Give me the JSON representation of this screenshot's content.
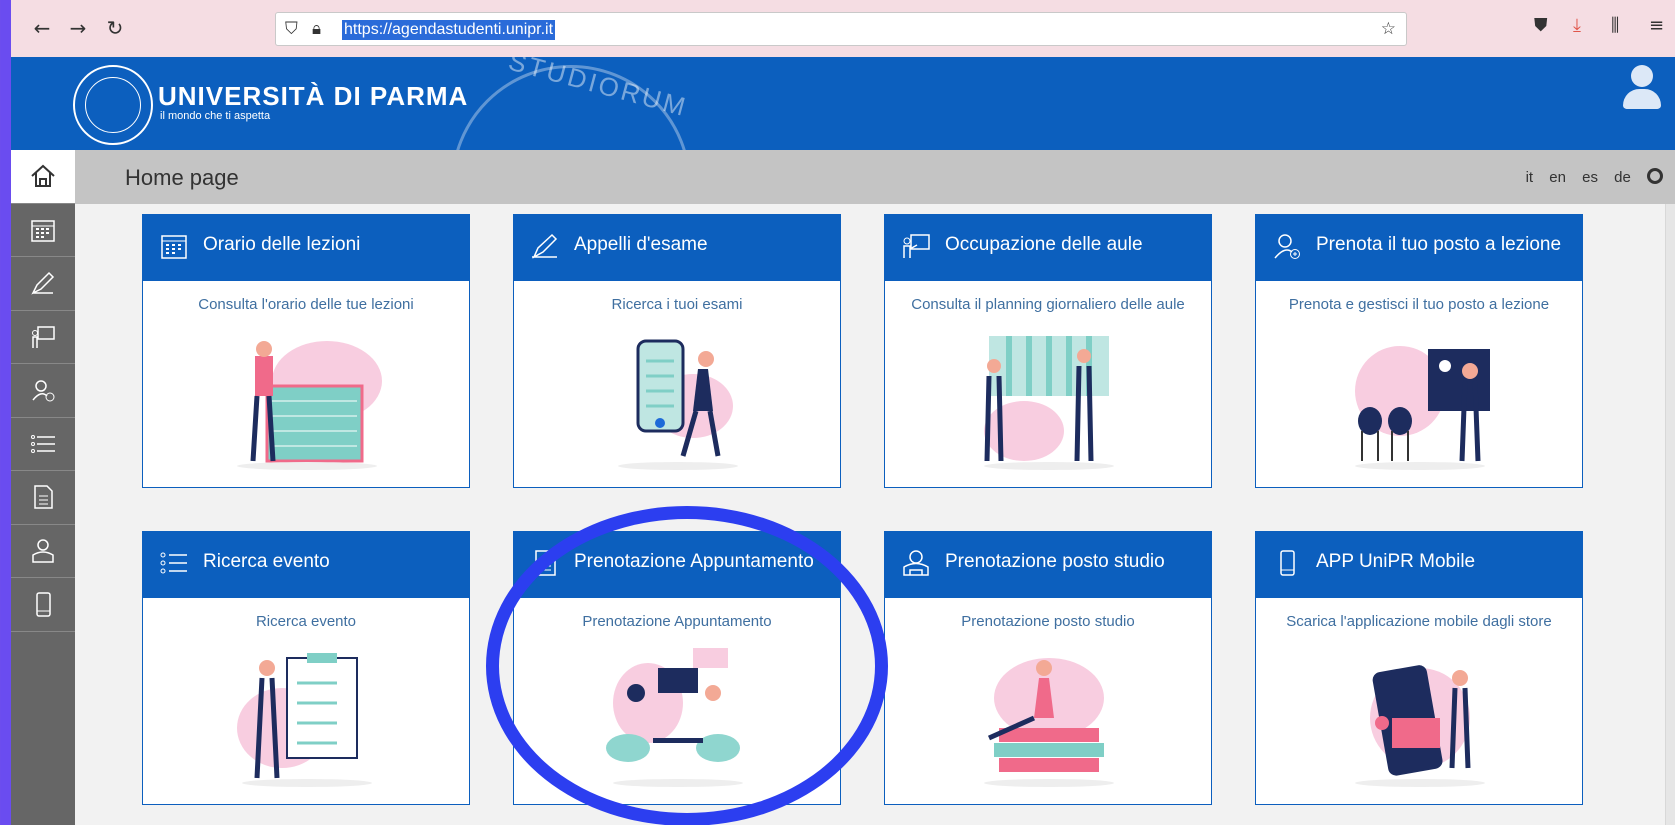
{
  "browser": {
    "url": "https://agendastudenti.unipr.it",
    "icons": [
      "back-icon",
      "forward-icon",
      "reload-icon",
      "shield-icon",
      "lock-icon",
      "bookmark-star-icon",
      "pocket-icon",
      "download-icon",
      "library-icon",
      "menu-icon"
    ]
  },
  "header": {
    "university_name": "UNIVERSITÀ DI PARMA",
    "tagline": "il mondo che ti aspetta",
    "watermark_text": "STUDIORUM"
  },
  "page": {
    "title": "Home page",
    "languages": [
      "it",
      "en",
      "es",
      "de"
    ]
  },
  "sidebar": {
    "items": [
      "home-icon",
      "calendar-icon",
      "exam-pen-icon",
      "classroom-icon",
      "booking-seat-icon",
      "list-icon",
      "document-icon",
      "study-seat-icon",
      "mobile-icon"
    ]
  },
  "cards": [
    {
      "title": "Orario delle lezioni",
      "description": "Consulta l'orario delle tue lezioni",
      "icon": "calendar-icon"
    },
    {
      "title": "Appelli d'esame",
      "description": "Ricerca i tuoi esami",
      "icon": "exam-pen-icon"
    },
    {
      "title": "Occupazione delle aule",
      "description": "Consulta il planning giornaliero delle aule",
      "icon": "classroom-icon"
    },
    {
      "title": "Prenota il tuo posto a lezione",
      "description": "Prenota e gestisci il tuo posto a lezione",
      "icon": "booking-seat-icon"
    },
    {
      "title": "Ricerca evento",
      "description": "Ricerca evento",
      "icon": "list-icon"
    },
    {
      "title": "Prenotazione Appuntamento",
      "description": "Prenotazione Appuntamento",
      "icon": "document-icon"
    },
    {
      "title": "Prenotazione posto studio",
      "description": "Prenotazione posto studio",
      "icon": "study-seat-icon"
    },
    {
      "title": "APP UniPR Mobile",
      "description": "Scarica l'applicazione mobile dagli store",
      "icon": "mobile-icon"
    }
  ],
  "colors": {
    "brand_blue": "#0c5fbe",
    "highlight_ring": "#2c3ef0",
    "sidebar_gray": "#666666"
  }
}
